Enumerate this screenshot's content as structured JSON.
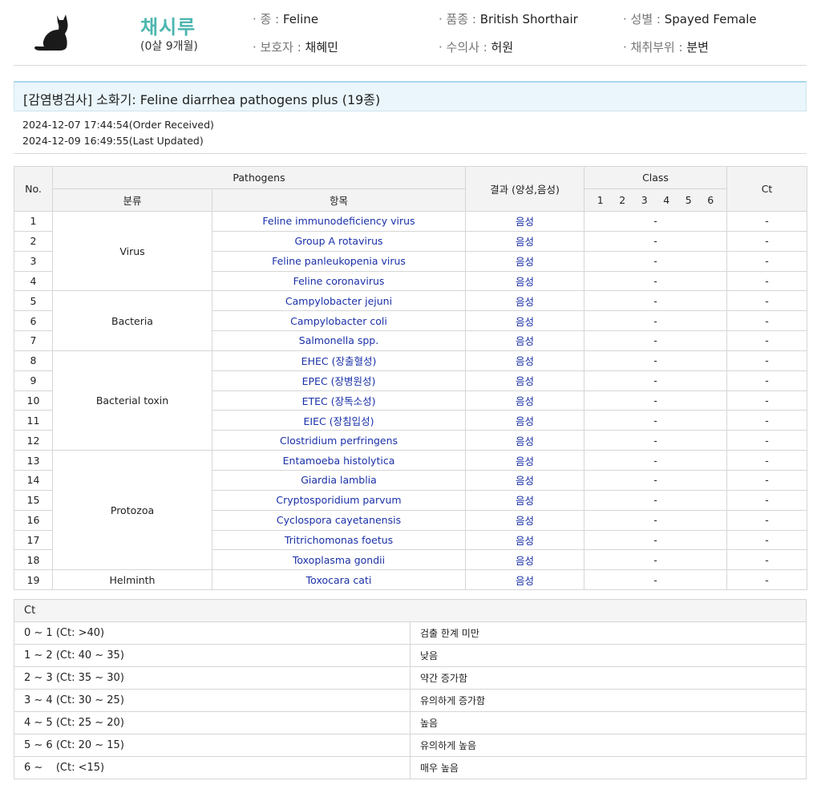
{
  "pet": {
    "name": "채시루",
    "age": "(0살 9개월)",
    "species_label": "· 종 :",
    "species": "Feline",
    "breed_label": "· 품종 :",
    "breed": "British Shorthair",
    "sex_label": "· 성별 :",
    "sex": "Spayed Female",
    "guardian_label": "· 보호자 :",
    "guardian": "채혜민",
    "vet_label": "· 수의사 :",
    "vet": "허원",
    "sample_label": "· 채취부위 :",
    "sample": "분변"
  },
  "test": {
    "title": "[감염병검사] 소화기: Feline diarrhea pathogens plus (19종)",
    "order_received": "2024-12-07 17:44:54(Order Received)",
    "last_updated": "2024-12-09 16:49:55(Last Updated)"
  },
  "table": {
    "headers": {
      "no": "No.",
      "pathogens": "Pathogens",
      "category": "분류",
      "item": "항목",
      "result": "결과 (양성,음성)",
      "class": "Class",
      "ct": "Ct",
      "class_nums": [
        "1",
        "2",
        "3",
        "4",
        "5",
        "6"
      ]
    },
    "groups": [
      "Virus",
      "Bacteria",
      "Bacterial toxin",
      "Protozoa",
      "Helminth"
    ],
    "rows": [
      {
        "no": "1",
        "item": "Feline immunodeficiency virus",
        "result": "음성",
        "class": "-",
        "ct": "-"
      },
      {
        "no": "2",
        "item": "Group A rotavirus",
        "result": "음성",
        "class": "-",
        "ct": "-"
      },
      {
        "no": "3",
        "item": "Feline panleukopenia virus",
        "result": "음성",
        "class": "-",
        "ct": "-"
      },
      {
        "no": "4",
        "item": "Feline coronavirus",
        "result": "음성",
        "class": "-",
        "ct": "-"
      },
      {
        "no": "5",
        "item": "Campylobacter jejuni",
        "result": "음성",
        "class": "-",
        "ct": "-"
      },
      {
        "no": "6",
        "item": "Campylobacter coli",
        "result": "음성",
        "class": "-",
        "ct": "-"
      },
      {
        "no": "7",
        "item": "Salmonella spp.",
        "result": "음성",
        "class": "-",
        "ct": "-"
      },
      {
        "no": "8",
        "item": "EHEC (장출혈성)",
        "result": "음성",
        "class": "-",
        "ct": "-"
      },
      {
        "no": "9",
        "item": "EPEC (장병원성)",
        "result": "음성",
        "class": "-",
        "ct": "-"
      },
      {
        "no": "10",
        "item": "ETEC (장독소성)",
        "result": "음성",
        "class": "-",
        "ct": "-"
      },
      {
        "no": "11",
        "item": "EIEC (장침입성)",
        "result": "음성",
        "class": "-",
        "ct": "-"
      },
      {
        "no": "12",
        "item": "Clostridium perfringens",
        "result": "음성",
        "class": "-",
        "ct": "-"
      },
      {
        "no": "13",
        "item": "Entamoeba histolytica",
        "result": "음성",
        "class": "-",
        "ct": "-"
      },
      {
        "no": "14",
        "item": "Giardia lamblia",
        "result": "음성",
        "class": "-",
        "ct": "-"
      },
      {
        "no": "15",
        "item": "Cryptosporidium parvum",
        "result": "음성",
        "class": "-",
        "ct": "-"
      },
      {
        "no": "16",
        "item": "Cyclospora cayetanensis",
        "result": "음성",
        "class": "-",
        "ct": "-"
      },
      {
        "no": "17",
        "item": "Tritrichomonas foetus",
        "result": "음성",
        "class": "-",
        "ct": "-"
      },
      {
        "no": "18",
        "item": "Toxoplasma gondii",
        "result": "음성",
        "class": "-",
        "ct": "-"
      },
      {
        "no": "19",
        "item": "Toxocara cati",
        "result": "음성",
        "class": "-",
        "ct": "-"
      }
    ]
  },
  "ct_legend": {
    "title": "Ct",
    "rows": [
      {
        "range": "0 ~ 1 (Ct: >40)",
        "desc": "검출 한계 미만"
      },
      {
        "range": "1 ~ 2 (Ct: 40 ~ 35)",
        "desc": "낮음"
      },
      {
        "range": "2 ~ 3 (Ct: 35 ~ 30)",
        "desc": "약간 증가함"
      },
      {
        "range": "3 ~ 4 (Ct: 30 ~ 25)",
        "desc": "유의하게 증가함"
      },
      {
        "range": "4 ~ 5 (Ct: 25 ~ 20)",
        "desc": "높음"
      },
      {
        "range": "5 ~ 6 (Ct: 20 ~ 15)",
        "desc": "유의하게 높음"
      },
      {
        "range": "6 ~    (Ct: <15)",
        "desc": "매우 높음"
      }
    ]
  },
  "colors": {
    "accent": "#4db6b0",
    "result_text": "#1a30a8",
    "title_bg": "#eaf6fb"
  },
  "icons": {
    "pet": "cat-silhouette-icon"
  }
}
